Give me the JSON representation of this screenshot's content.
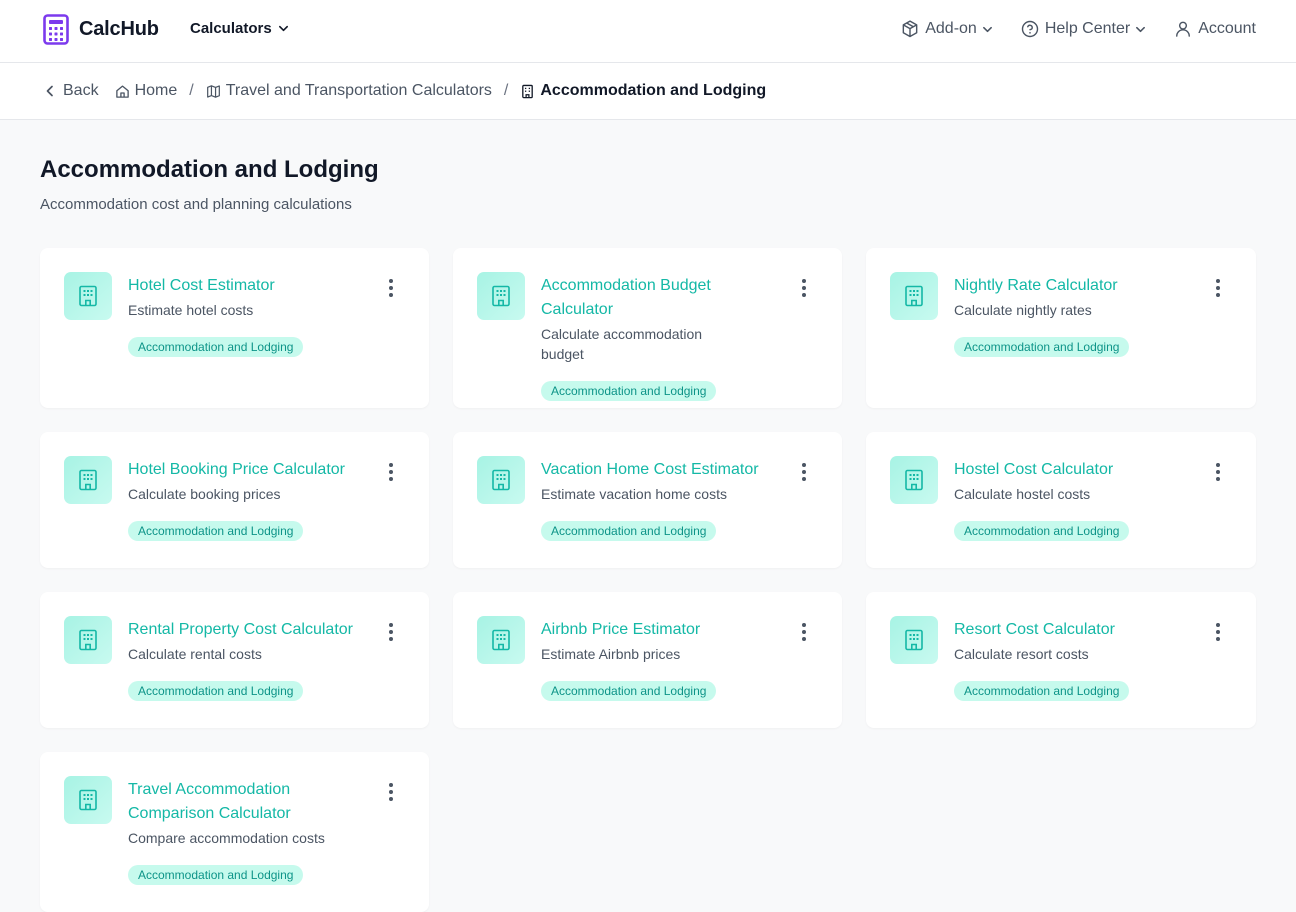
{
  "header": {
    "brand": "CalcHub",
    "calculators_label": "Calculators",
    "addon_label": "Add-on",
    "help_label": "Help Center",
    "account_label": "Account"
  },
  "breadcrumb": {
    "back": "Back",
    "home": "Home",
    "category": "Travel and Transportation Calculators",
    "current": "Accommodation and Lodging"
  },
  "page": {
    "title": "Accommodation and Lodging",
    "subtitle": "Accommodation cost and planning calculations"
  },
  "cards": [
    {
      "title": "Hotel Cost Estimator",
      "desc": "Estimate hotel costs",
      "tag": "Accommodation and Lodging"
    },
    {
      "title": "Accommodation Budget Calculator",
      "desc": "Calculate accommodation budget",
      "tag": "Accommodation and Lodging"
    },
    {
      "title": "Nightly Rate Calculator",
      "desc": "Calculate nightly rates",
      "tag": "Accommodation and Lodging"
    },
    {
      "title": "Hotel Booking Price Calculator",
      "desc": "Calculate booking prices",
      "tag": "Accommodation and Lodging"
    },
    {
      "title": "Vacation Home Cost Estimator",
      "desc": "Estimate vacation home costs",
      "tag": "Accommodation and Lodging"
    },
    {
      "title": "Hostel Cost Calculator",
      "desc": "Calculate hostel costs",
      "tag": "Accommodation and Lodging"
    },
    {
      "title": "Rental Property Cost Calculator",
      "desc": "Calculate rental costs",
      "tag": "Accommodation and Lodging"
    },
    {
      "title": "Airbnb Price Estimator",
      "desc": "Estimate Airbnb prices",
      "tag": "Accommodation and Lodging"
    },
    {
      "title": "Resort Cost Calculator",
      "desc": "Calculate resort costs",
      "tag": "Accommodation and Lodging"
    },
    {
      "title": "Travel Accommodation Comparison Calculator",
      "desc": "Compare accommodation costs",
      "tag": "Accommodation and Lodging"
    }
  ],
  "colors": {
    "accent": "#14b8a6",
    "tag_bg": "#c6faed",
    "brand_icon": "#7c3aed"
  }
}
